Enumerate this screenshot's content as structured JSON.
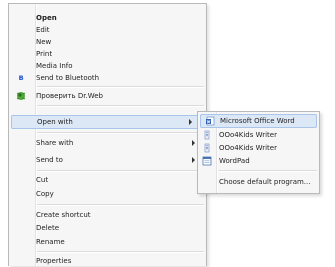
{
  "context_menu": {
    "items": [
      {
        "label": "Open"
      },
      {
        "label": "Edit"
      },
      {
        "label": "New"
      },
      {
        "label": "Print"
      },
      {
        "label": "Media Info"
      },
      {
        "label": "Send to Bluetooth"
      },
      {
        "label": "Проверить Dr.Web"
      },
      {
        "label": "Open with"
      },
      {
        "label": "Share with"
      },
      {
        "label": "Send to"
      },
      {
        "label": "Cut"
      },
      {
        "label": "Copy"
      },
      {
        "label": "Create shortcut"
      },
      {
        "label": "Delete"
      },
      {
        "label": "Rename"
      },
      {
        "label": "Properties"
      }
    ]
  },
  "open_with_menu": {
    "items": [
      {
        "label": "Microsoft Office Word"
      },
      {
        "label": "OOo4Kids Writer"
      },
      {
        "label": "OOo4Kids Writer"
      },
      {
        "label": "WordPad"
      },
      {
        "label": "Choose default program..."
      }
    ]
  },
  "icons": {
    "bluetooth": "bluetooth-icon",
    "drweb": "drweb-spider-icon",
    "word": "word-doc-icon",
    "ooo4kids": "ooo4kids-writer-icon",
    "wordpad": "wordpad-icon"
  },
  "colors": {
    "highlight_bg": "#dde8f6",
    "highlight_border": "#a9c5ea"
  }
}
